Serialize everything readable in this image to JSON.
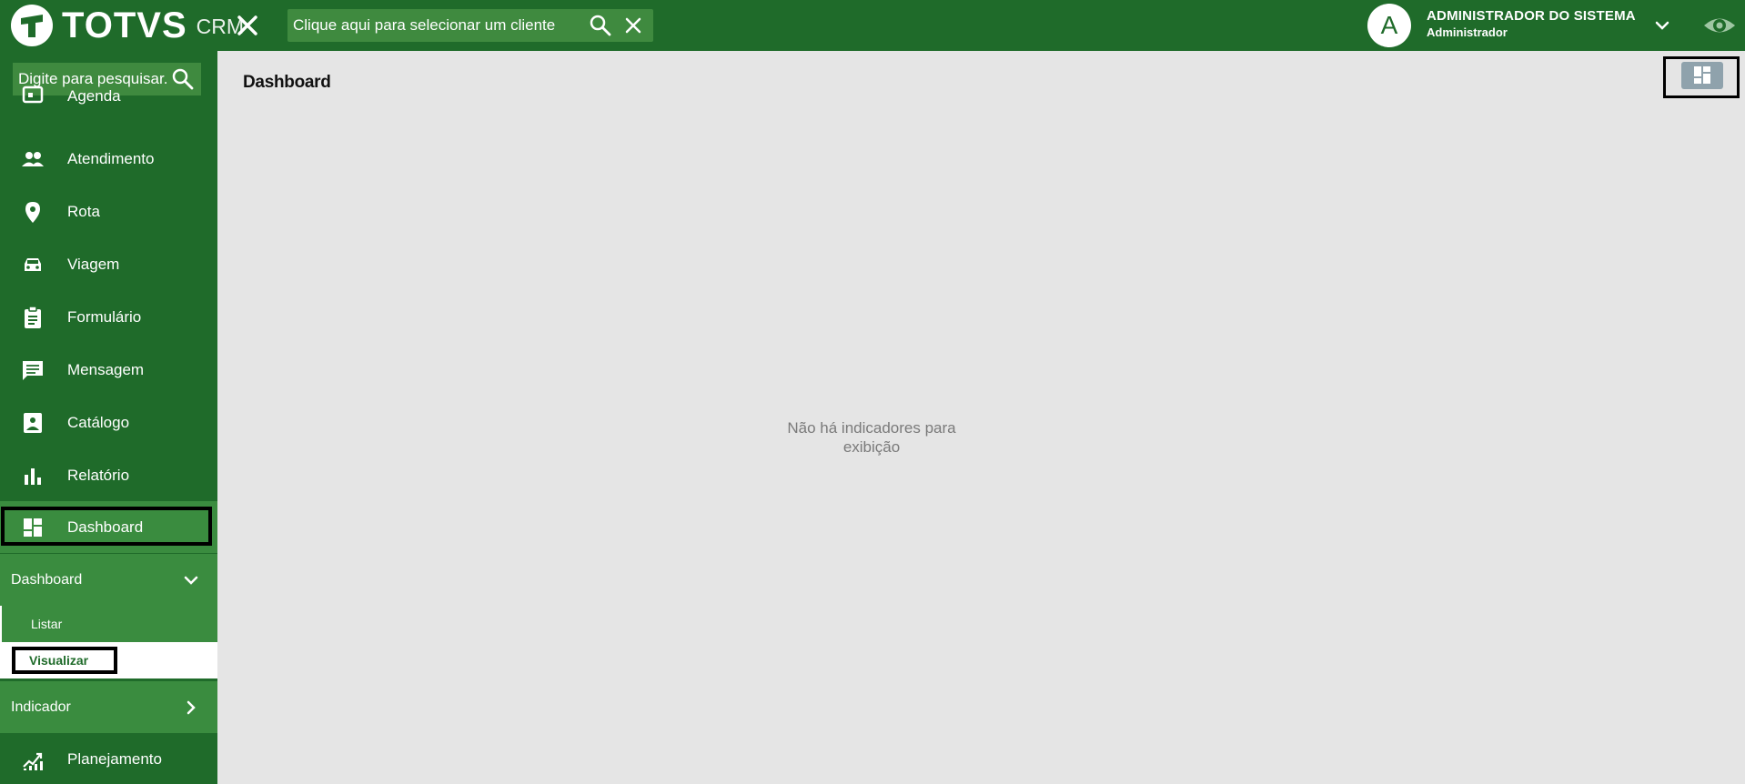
{
  "header": {
    "logo_text": "TOTVS",
    "logo_sub": "CRM",
    "client_search_placeholder": "Clique aqui para selecionar um cliente",
    "avatar_letter": "A",
    "user_name": "ADMINISTRADOR DO SISTEMA",
    "user_role": "Administrador"
  },
  "sidebar": {
    "search_placeholder": "Digite para pesquisar...",
    "items": [
      {
        "label": "Agenda",
        "icon": "calendar-icon"
      },
      {
        "label": "Atendimento",
        "icon": "people-icon"
      },
      {
        "label": "Rota",
        "icon": "location-pin-icon"
      },
      {
        "label": "Viagem",
        "icon": "car-icon"
      },
      {
        "label": "Formulário",
        "icon": "clipboard-icon"
      },
      {
        "label": "Mensagem",
        "icon": "message-icon"
      },
      {
        "label": "Catálogo",
        "icon": "image-icon"
      },
      {
        "label": "Relatório",
        "icon": "bar-chart-icon"
      },
      {
        "label": "Dashboard",
        "icon": "dashboard-icon"
      }
    ],
    "dashboard_group": {
      "label": "Dashboard",
      "children": [
        "Listar",
        "Visualizar"
      ]
    },
    "indicador_group": {
      "label": "Indicador"
    },
    "planejamento": {
      "label": "Planejamento",
      "icon": "trending-icon"
    }
  },
  "main": {
    "title": "Dashboard",
    "empty_message": "Não há indicadores para exibição"
  },
  "colors": {
    "header_green": "#1f6b2a",
    "active_green": "#3a8c3f",
    "content_bg": "#e5e5e5"
  }
}
